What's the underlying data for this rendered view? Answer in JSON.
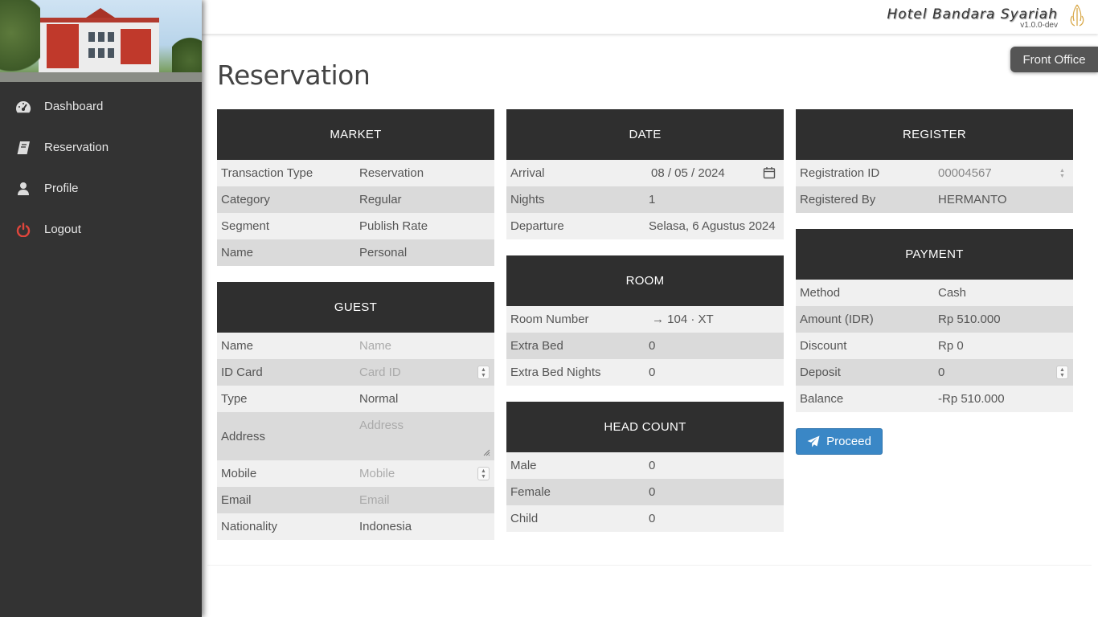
{
  "header": {
    "brand_name": "Hotel Bandara Syariah",
    "version": "v1.0.0-dev",
    "role_badge": "Front Office"
  },
  "sidebar": {
    "items": [
      {
        "label": "Dashboard",
        "icon": "dashboard-icon"
      },
      {
        "label": "Reservation",
        "icon": "book-icon"
      },
      {
        "label": "Profile",
        "icon": "user-icon"
      },
      {
        "label": "Logout",
        "icon": "power-icon",
        "color": "#e0463c"
      }
    ]
  },
  "page": {
    "title": "Reservation"
  },
  "market": {
    "title": "MARKET",
    "rows": [
      {
        "label": "Transaction Type",
        "value": "Reservation"
      },
      {
        "label": "Category",
        "value": "Regular"
      },
      {
        "label": "Segment",
        "value": "Publish Rate"
      },
      {
        "label": "Name",
        "value": "Personal"
      }
    ]
  },
  "guest": {
    "title": "GUEST",
    "rows": [
      {
        "label": "Name",
        "placeholder": "Name"
      },
      {
        "label": "ID Card",
        "placeholder": "Card ID"
      },
      {
        "label": "Type",
        "value": "Normal"
      },
      {
        "label": "Address",
        "placeholder": "Address"
      },
      {
        "label": "Mobile",
        "placeholder": "Mobile"
      },
      {
        "label": "Email",
        "placeholder": "Email"
      },
      {
        "label": "Nationality",
        "value": "Indonesia"
      }
    ]
  },
  "date": {
    "title": "DATE",
    "rows": [
      {
        "label": "Arrival",
        "value": "08 / 05 / 2024"
      },
      {
        "label": "Nights",
        "value": "1"
      },
      {
        "label": "Departure",
        "value": "Selasa, 6 Agustus 2024"
      }
    ]
  },
  "room": {
    "title": "ROOM",
    "rows": [
      {
        "label": "Room Number",
        "value": "→ 104 · XT"
      },
      {
        "label": "Extra Bed",
        "value": "0"
      },
      {
        "label": "Extra Bed Nights",
        "value": "0"
      }
    ]
  },
  "headcount": {
    "title": "HEAD COUNT",
    "rows": [
      {
        "label": "Male",
        "value": "0"
      },
      {
        "label": "Female",
        "value": "0"
      },
      {
        "label": "Child",
        "value": "0"
      }
    ]
  },
  "register": {
    "title": "REGISTER",
    "rows": [
      {
        "label": "Registration ID",
        "value": "00004567"
      },
      {
        "label": "Registered By",
        "value": "HERMANTO"
      }
    ]
  },
  "payment": {
    "title": "PAYMENT",
    "rows": [
      {
        "label": "Method",
        "value": "Cash"
      },
      {
        "label": "Amount (IDR)",
        "value": "Rp 510.000"
      },
      {
        "label": "Discount",
        "value": "Rp 0"
      },
      {
        "label": "Deposit",
        "value": "0"
      },
      {
        "label": "Balance",
        "value": "-Rp 510.000"
      }
    ]
  },
  "actions": {
    "proceed_label": "Proceed",
    "accent": "#3a87c6"
  }
}
